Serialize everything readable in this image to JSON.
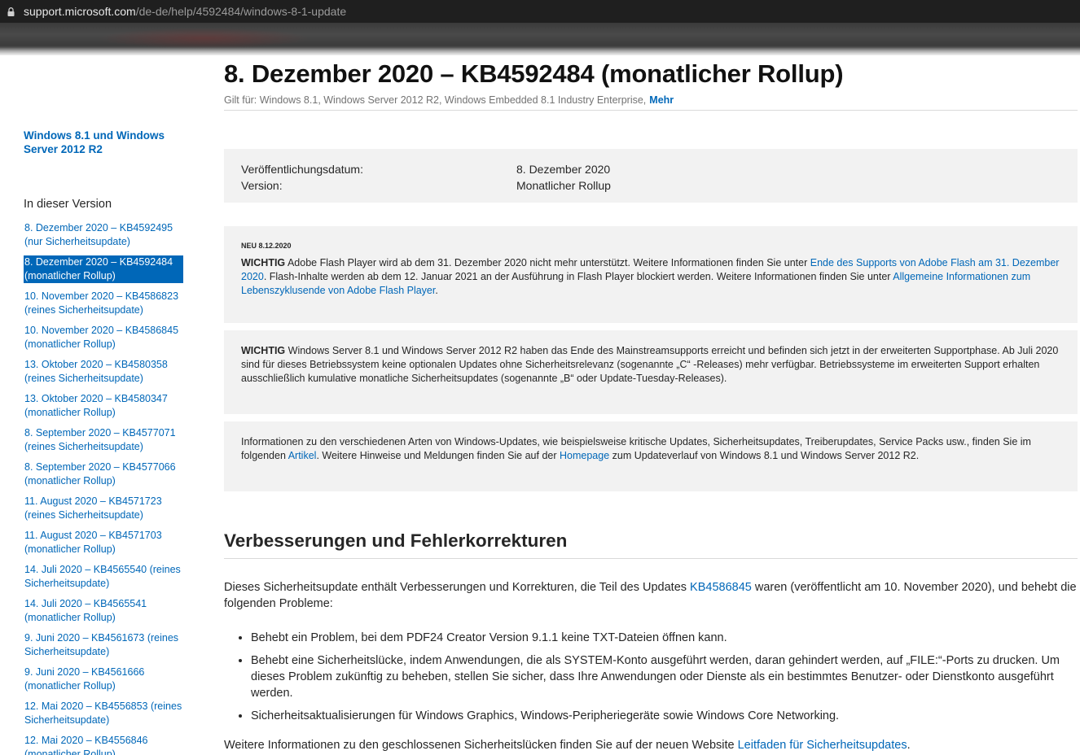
{
  "browser": {
    "url_host": "support.microsoft.com",
    "url_path": "/de-de/help/4592484/windows-8-1-update"
  },
  "sidebar": {
    "title": "Windows 8.1 und Windows Server 2012 R2",
    "section_heading": "In dieser Version",
    "items": [
      {
        "line1": "8. Dezember 2020 – KB4592495",
        "line2": "(nur Sicherheitsupdate)"
      },
      {
        "line1": "8. Dezember 2020 – KB4592484",
        "line2": "(monatlicher Rollup)"
      },
      {
        "line1": "10. November 2020 – KB4586823",
        "line2": "(reines Sicherheitsupdate)"
      },
      {
        "line1": "10. November 2020 – KB4586845",
        "line2": "(monatlicher Rollup)"
      },
      {
        "line1": "13. Oktober 2020 – KB4580358",
        "line2": "(reines Sicherheitsupdate)"
      },
      {
        "line1": "13. Oktober 2020 – KB4580347",
        "line2": "(monatlicher Rollup)"
      },
      {
        "line1": "8. September 2020 – KB4577071",
        "line2": "(reines Sicherheitsupdate)"
      },
      {
        "line1": "8. September 2020 – KB4577066",
        "line2": "(monatlicher Rollup)"
      },
      {
        "line1": "11. August 2020 – KB4571723",
        "line2": "(reines Sicherheitsupdate)"
      },
      {
        "line1": "11. August 2020 – KB4571703",
        "line2": "(monatlicher Rollup)"
      },
      {
        "line1": "14. Juli 2020 – KB4565540 (reines",
        "line2": "Sicherheitsupdate)"
      },
      {
        "line1": "14. Juli 2020 – KB4565541",
        "line2": "(monatlicher Rollup)"
      },
      {
        "line1": "9. Juni 2020 – KB4561673 (reines",
        "line2": "Sicherheitsupdate)"
      },
      {
        "line1": "9. Juni 2020 – KB4561666",
        "line2": "(monatlicher Rollup)"
      },
      {
        "line1": "12. Mai 2020 – KB4556853 (reines",
        "line2": "Sicherheitsupdate)"
      },
      {
        "line1": "12. Mai 2020 – KB4556846",
        "line2": "(monatlicher Rollup)"
      }
    ]
  },
  "main": {
    "title": "8. Dezember 2020 – KB4592484 (monatlicher Rollup)",
    "applies_to": "Gilt für: Windows 8.1, Windows Server 2012 R2, Windows Embedded 8.1 Industry Enterprise,",
    "more_link": "Mehr",
    "info": {
      "date_label": "Veröffentlichungsdatum:",
      "date_value": "8. Dezember 2020",
      "version_label": "Version:",
      "version_value": "Monatlicher Rollup"
    },
    "note1": {
      "tag": "NEU 8.12.2020",
      "important": "WICHTIG",
      "text1": " Adobe Flash Player wird ab dem 31. Dezember 2020 nicht mehr unterstützt. Weitere Informationen finden Sie unter ",
      "link1": "Ende des Supports von Adobe Flash am 31. Dezember 2020",
      "text2": ". Flash-Inhalte werden ab dem 12. Januar 2021 an der Ausführung in Flash Player blockiert werden. Weitere Informationen finden Sie unter ",
      "link2": "Allgemeine Informationen zum Lebenszyklusende von Adobe Flash Player",
      "text3": "."
    },
    "note2": {
      "important": "WICHTIG",
      "text": " Windows Server 8.1 und Windows Server 2012 R2 haben das Ende des Mainstreamsupports erreicht und befinden sich jetzt in der erweiterten Supportphase. Ab Juli 2020 sind für dieses Betriebssystem keine optionalen Updates ohne Sicherheitsrelevanz (sogenannte „C“ -Releases) mehr verfügbar. Betriebssysteme im erweiterten Support erhalten ausschließlich kumulative monatliche Sicherheitsupdates (sogenannte „B“ oder Update-Tuesday-Releases)."
    },
    "note3": {
      "text1": "Informationen zu den verschiedenen Arten von Windows-Updates, wie beispielsweise kritische Updates, Sicherheitsupdates, Treiberupdates, Service Packs usw., finden Sie im folgenden ",
      "link1": "Artikel",
      "text2": ". Weitere Hinweise und Meldungen finden Sie auf der ",
      "link2": "Homepage",
      "text3": " zum Updateverlauf von Windows 8.1 und Windows Server 2012 R2."
    },
    "section_heading": "Verbesserungen und Fehlerkorrekturen",
    "intro_text1": "Dieses Sicherheitsupdate enthält Verbesserungen und Korrekturen, die Teil des Updates ",
    "intro_link": "KB4586845",
    "intro_text2": " waren (veröffentlicht am 10. November 2020), und behebt die folgenden Probleme:",
    "bullets": [
      "Behebt ein Problem, bei dem PDF24 Creator Version 9.1.1 keine TXT-Dateien öffnen kann.",
      "Behebt eine Sicherheitslücke, indem Anwendungen, die als SYSTEM-Konto ausgeführt werden, daran gehindert werden, auf „FILE:“-Ports zu drucken. Um dieses Problem zukünftig zu beheben, stellen Sie sicher, dass Ihre Anwendungen oder Dienste als ein bestimmtes Benutzer- oder Dienstkonto ausgeführt werden.",
      "Sicherheitsaktualisierungen für Windows Graphics, Windows-Peripheriegeräte sowie Windows Core Networking."
    ],
    "outro_text": "Weitere Informationen zu den geschlossenen Sicherheitslücken finden Sie auf der neuen Website ",
    "outro_link": "Leitfaden für Sicherheitsupdates",
    "outro_end": "."
  }
}
